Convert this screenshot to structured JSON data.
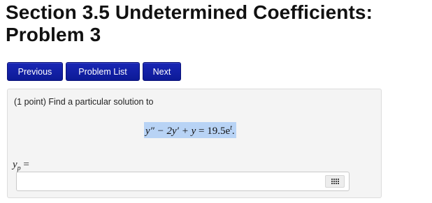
{
  "page": {
    "title": "Section 3.5 Undetermined Coefficients: Problem 3"
  },
  "nav": {
    "previous_label": "Previous",
    "problem_list_label": "Problem List",
    "next_label": "Next",
    "button_color": "#0c1a96"
  },
  "problem": {
    "prompt": "(1 point) Find a particular solution to",
    "equation_lhs": "y″ − 2y′ + y",
    "equation_rhs": "19.5e",
    "equation_rhs_exponent": "t",
    "equation_end": ".",
    "answer_label_var": "y",
    "answer_label_sub": "p",
    "answer_label_eq": " =",
    "answer_value": "",
    "keypad_icon": "keypad-grid-icon"
  }
}
